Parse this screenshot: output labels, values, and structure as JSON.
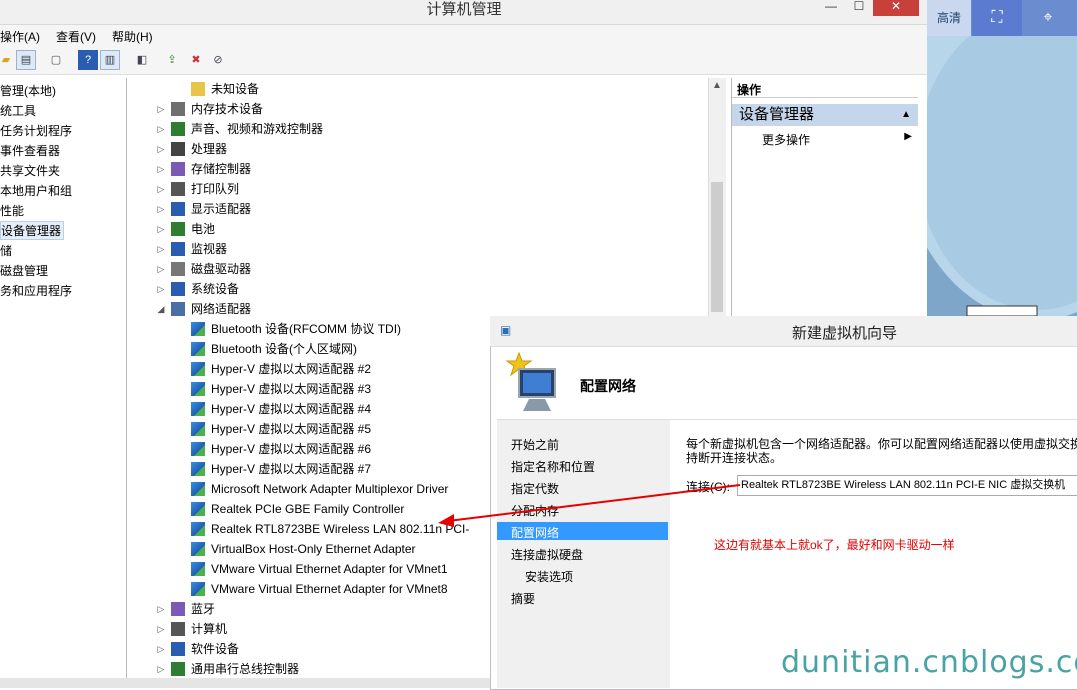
{
  "window": {
    "title": "计算机管理",
    "min_glyph": "—",
    "max_glyph": "☐",
    "close_glyph": "✕"
  },
  "menu": [
    "操作(A)",
    "查看(V)",
    "帮助(H)"
  ],
  "left_tree": [
    "管理(本地)",
    "统工具",
    "任务计划程序",
    "事件查看器",
    "共享文件夹",
    "本地用户和组",
    "性能",
    "设备管理器",
    "储",
    "磁盘管理",
    "务和应用程序"
  ],
  "devices": [
    {
      "label": "未知设备",
      "level": 2
    },
    {
      "label": "内存技术设备",
      "level": 1
    },
    {
      "label": "声音、视频和游戏控制器",
      "level": 1
    },
    {
      "label": "处理器",
      "level": 1
    },
    {
      "label": "存储控制器",
      "level": 1
    },
    {
      "label": "打印队列",
      "level": 1
    },
    {
      "label": "显示适配器",
      "level": 1
    },
    {
      "label": "电池",
      "level": 1
    },
    {
      "label": "监视器",
      "level": 1
    },
    {
      "label": "磁盘驱动器",
      "level": 1
    },
    {
      "label": "系统设备",
      "level": 1
    },
    {
      "label": "网络适配器",
      "level": 1,
      "expanded": true
    },
    {
      "label": "Bluetooth 设备(RFCOMM 协议 TDI)",
      "level": 2
    },
    {
      "label": "Bluetooth 设备(个人区域网)",
      "level": 2
    },
    {
      "label": "Hyper-V 虚拟以太网适配器 #2",
      "level": 2
    },
    {
      "label": "Hyper-V 虚拟以太网适配器 #3",
      "level": 2
    },
    {
      "label": "Hyper-V 虚拟以太网适配器 #4",
      "level": 2
    },
    {
      "label": "Hyper-V 虚拟以太网适配器 #5",
      "level": 2
    },
    {
      "label": "Hyper-V 虚拟以太网适配器 #6",
      "level": 2
    },
    {
      "label": "Hyper-V 虚拟以太网适配器 #7",
      "level": 2
    },
    {
      "label": "Microsoft Network Adapter Multiplexor Driver",
      "level": 2
    },
    {
      "label": "Realtek PCIe GBE Family Controller",
      "level": 2
    },
    {
      "label": "Realtek RTL8723BE Wireless LAN 802.11n PCI-",
      "level": 2
    },
    {
      "label": "VirtualBox Host-Only Ethernet Adapter",
      "level": 2
    },
    {
      "label": "VMware Virtual Ethernet Adapter for VMnet1",
      "level": 2
    },
    {
      "label": "VMware Virtual Ethernet Adapter for VMnet8",
      "level": 2
    },
    {
      "label": "蓝牙",
      "level": 1
    },
    {
      "label": "计算机",
      "level": 1
    },
    {
      "label": "软件设备",
      "level": 1
    },
    {
      "label": "通用串行总线控制器",
      "level": 1
    }
  ],
  "actions": {
    "header": "操作",
    "section": "设备管理器",
    "more": "更多操作"
  },
  "right_toolbar": {
    "label": "高清"
  },
  "wizard": {
    "title": "新建虚拟机向导",
    "heading": "配置网络",
    "nav": [
      "开始之前",
      "指定名称和位置",
      "指定代数",
      "分配内存",
      "配置网络",
      "连接虚拟硬盘",
      "安装选项",
      "摘要"
    ],
    "selected_nav": "配置网络",
    "desc_line1": "每个新虚拟机包含一个网络适配器。你可以配置网络适配器以使用虚拟交换",
    "desc_line2": "持断开连接状态。",
    "connection_label": "连接(C):",
    "connection_value": "Realtek RTL8723BE Wireless LAN 802.11n PCI-E NIC 虚拟交换机"
  },
  "annotation": "这边有就基本上就ok了，最好和网卡驱动一样",
  "watermark": "dunitian.cnblogs.com",
  "colors": {
    "accent": "#3399ff",
    "annotation": "#e60000",
    "watermark": "#4aa3a3",
    "selection": "#3399ff"
  }
}
